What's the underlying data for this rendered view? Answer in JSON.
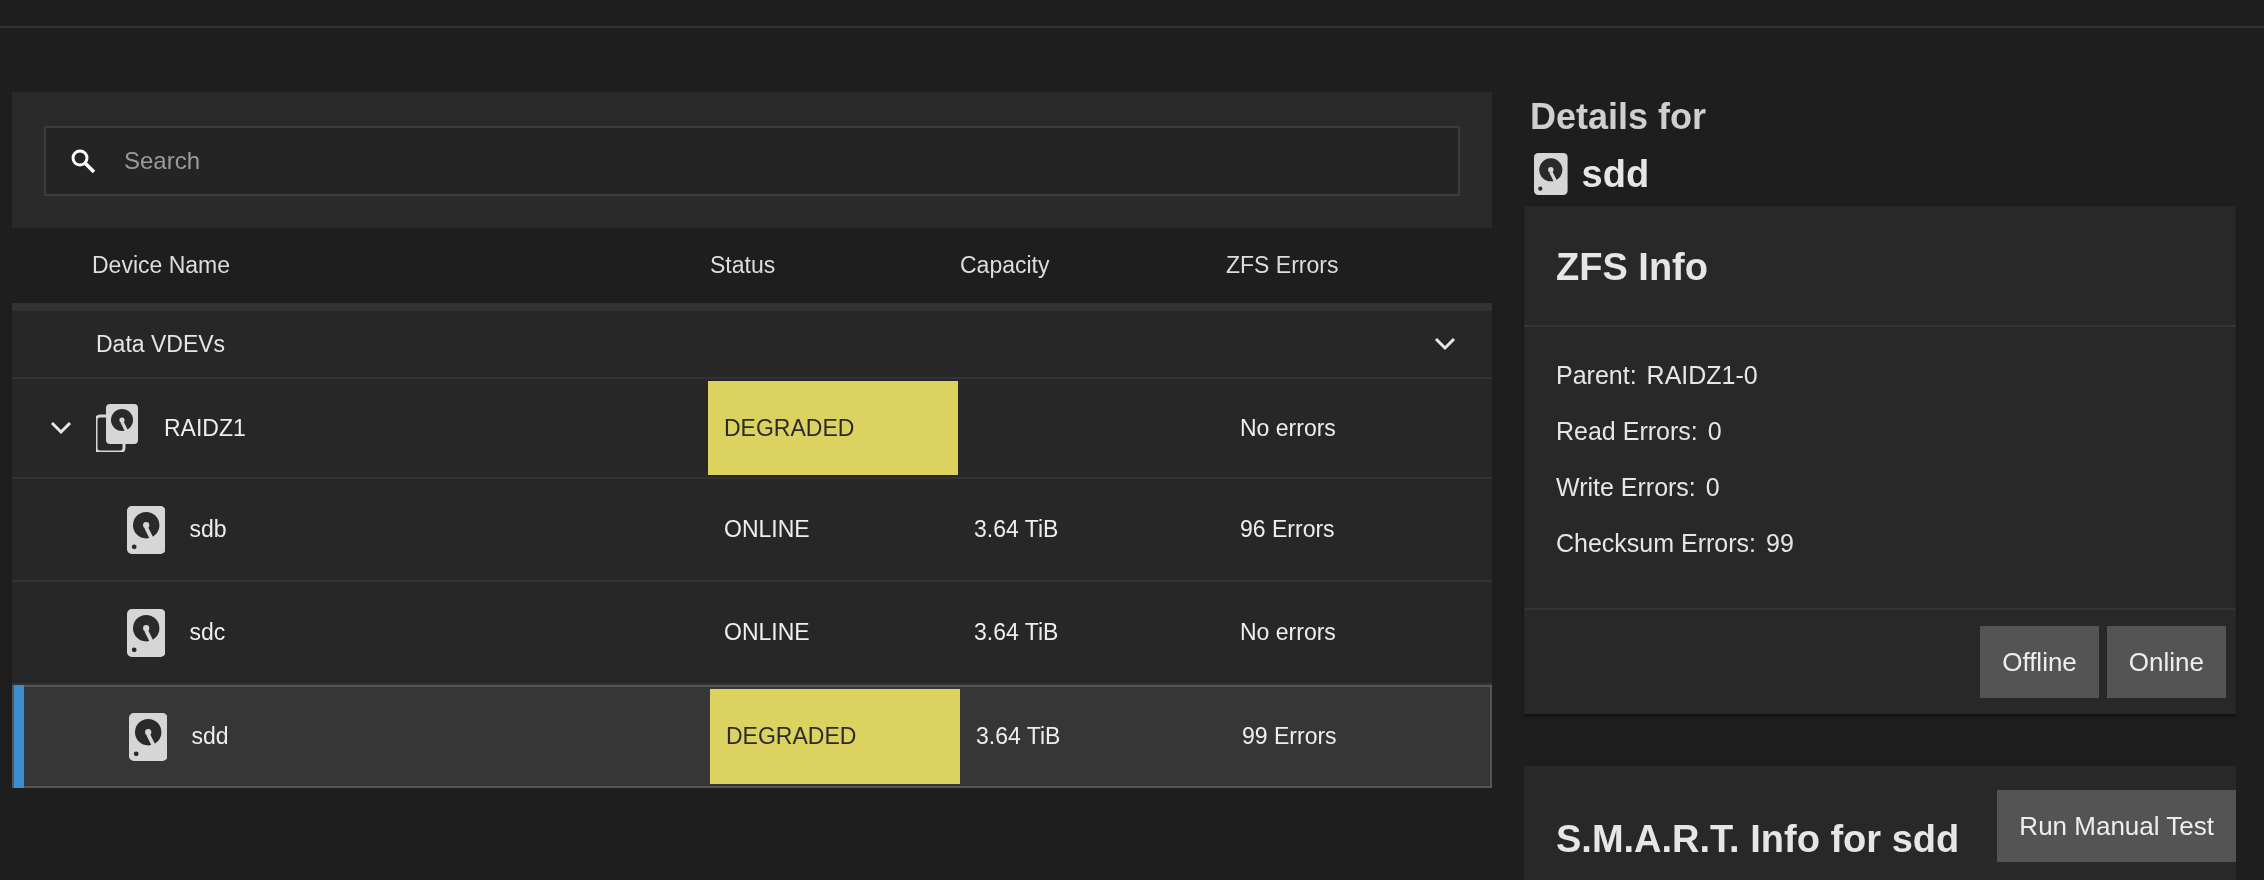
{
  "search": {
    "placeholder": "Search"
  },
  "table": {
    "columns": [
      "Device Name",
      "Status",
      "Capacity",
      "ZFS Errors"
    ],
    "groups": [
      {
        "label": "Data VDEVs",
        "expanded": true,
        "rows": [
          {
            "kind": "vdev",
            "name": "RAIDZ1",
            "status": "DEGRADED",
            "warning": true,
            "capacity": "",
            "errors": "No errors",
            "expanded": true,
            "selected": false,
            "children": [
              {
                "kind": "disk",
                "name": "sdb",
                "status": "ONLINE",
                "warning": false,
                "capacity": "3.64 TiB",
                "errors": "96 Errors",
                "selected": false
              },
              {
                "kind": "disk",
                "name": "sdc",
                "status": "ONLINE",
                "warning": false,
                "capacity": "3.64 TiB",
                "errors": "No errors",
                "selected": false
              },
              {
                "kind": "disk",
                "name": "sdd",
                "status": "DEGRADED",
                "warning": true,
                "capacity": "3.64 TiB",
                "errors": "99 Errors",
                "selected": true
              }
            ]
          }
        ]
      }
    ]
  },
  "details": {
    "heading": "Details for",
    "device": "sdd",
    "zfs_info": {
      "title": "ZFS Info",
      "fields": [
        {
          "label": "Parent:",
          "value": "RAIDZ1-0"
        },
        {
          "label": "Read Errors:",
          "value": "0"
        },
        {
          "label": "Write Errors:",
          "value": "0"
        },
        {
          "label": "Checksum Errors:",
          "value": "99"
        }
      ],
      "buttons": [
        "Offline",
        "Online"
      ]
    },
    "smart": {
      "title": "S.M.A.R.T. Info for sdd",
      "button": "Run Manual Test"
    }
  }
}
